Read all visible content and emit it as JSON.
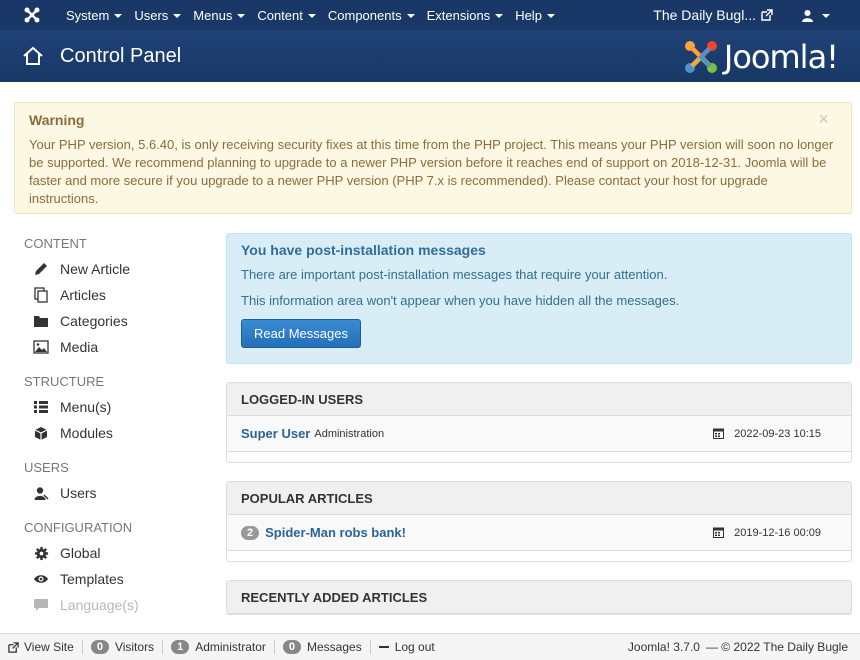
{
  "topnav": {
    "menu": [
      {
        "label": "System"
      },
      {
        "label": "Users"
      },
      {
        "label": "Menus"
      },
      {
        "label": "Content"
      },
      {
        "label": "Components"
      },
      {
        "label": "Extensions"
      },
      {
        "label": "Help"
      }
    ],
    "site_name": "The Daily Bugl...",
    "colors": {
      "navbar": "#1a3867",
      "header": "#1c3d6e"
    }
  },
  "header": {
    "title": "Control Panel",
    "brand": "Joomla!"
  },
  "warning": {
    "title": "Warning",
    "message": "Your PHP version, 5.6.40, is only receiving security fixes at this time from the PHP project. This means your PHP version will soon no longer be supported. We recommend planning to upgrade to a newer PHP version before it reaches end of support on 2018-12-31. Joomla will be faster and more secure if you upgrade to a newer PHP version (PHP 7.x is recommended). Please contact your host for upgrade instructions.",
    "close": "×"
  },
  "sidebar": {
    "content_heading": "CONTENT",
    "content_items": [
      {
        "label": "New Article",
        "icon": "pencil-icon"
      },
      {
        "label": "Articles",
        "icon": "copy-icon"
      },
      {
        "label": "Categories",
        "icon": "folder-icon"
      },
      {
        "label": "Media",
        "icon": "image-icon"
      }
    ],
    "structure_heading": "STRUCTURE",
    "structure_items": [
      {
        "label": "Menu(s)",
        "icon": "list-icon"
      },
      {
        "label": "Modules",
        "icon": "cube-icon"
      }
    ],
    "users_heading": "USERS",
    "users_items": [
      {
        "label": "Users",
        "icon": "user-icon"
      }
    ],
    "config_heading": "CONFIGURATION",
    "config_items": [
      {
        "label": "Global",
        "icon": "cog-icon"
      },
      {
        "label": "Templates",
        "icon": "eye-icon"
      },
      {
        "label": "Language(s)",
        "icon": "comment-icon"
      }
    ]
  },
  "postinstall": {
    "title": "You have post-installation messages",
    "line1": "There are important post-installation messages that require your attention.",
    "line2": "This information area won't appear when you have hidden all the messages.",
    "button": "Read Messages"
  },
  "logged_in": {
    "heading": "LOGGED-IN USERS",
    "user": "Super User",
    "area": "Administration",
    "date": "2022-09-23 10:15"
  },
  "popular": {
    "heading": "POPULAR ARTICLES",
    "hits": "2",
    "title": "Spider-Man robs bank!",
    "date": "2019-12-16 00:09"
  },
  "recent": {
    "heading": "RECENTLY ADDED ARTICLES"
  },
  "status": {
    "view_site": "View Site",
    "visitors_count": "0",
    "visitors": "Visitors",
    "admin_count": "1",
    "admin": "Administrator",
    "messages_count": "0",
    "messages": "Messages",
    "logout": "Log out",
    "version": "Joomla! 3.7.0",
    "copyright": "— © 2022 The Daily Bugle"
  }
}
